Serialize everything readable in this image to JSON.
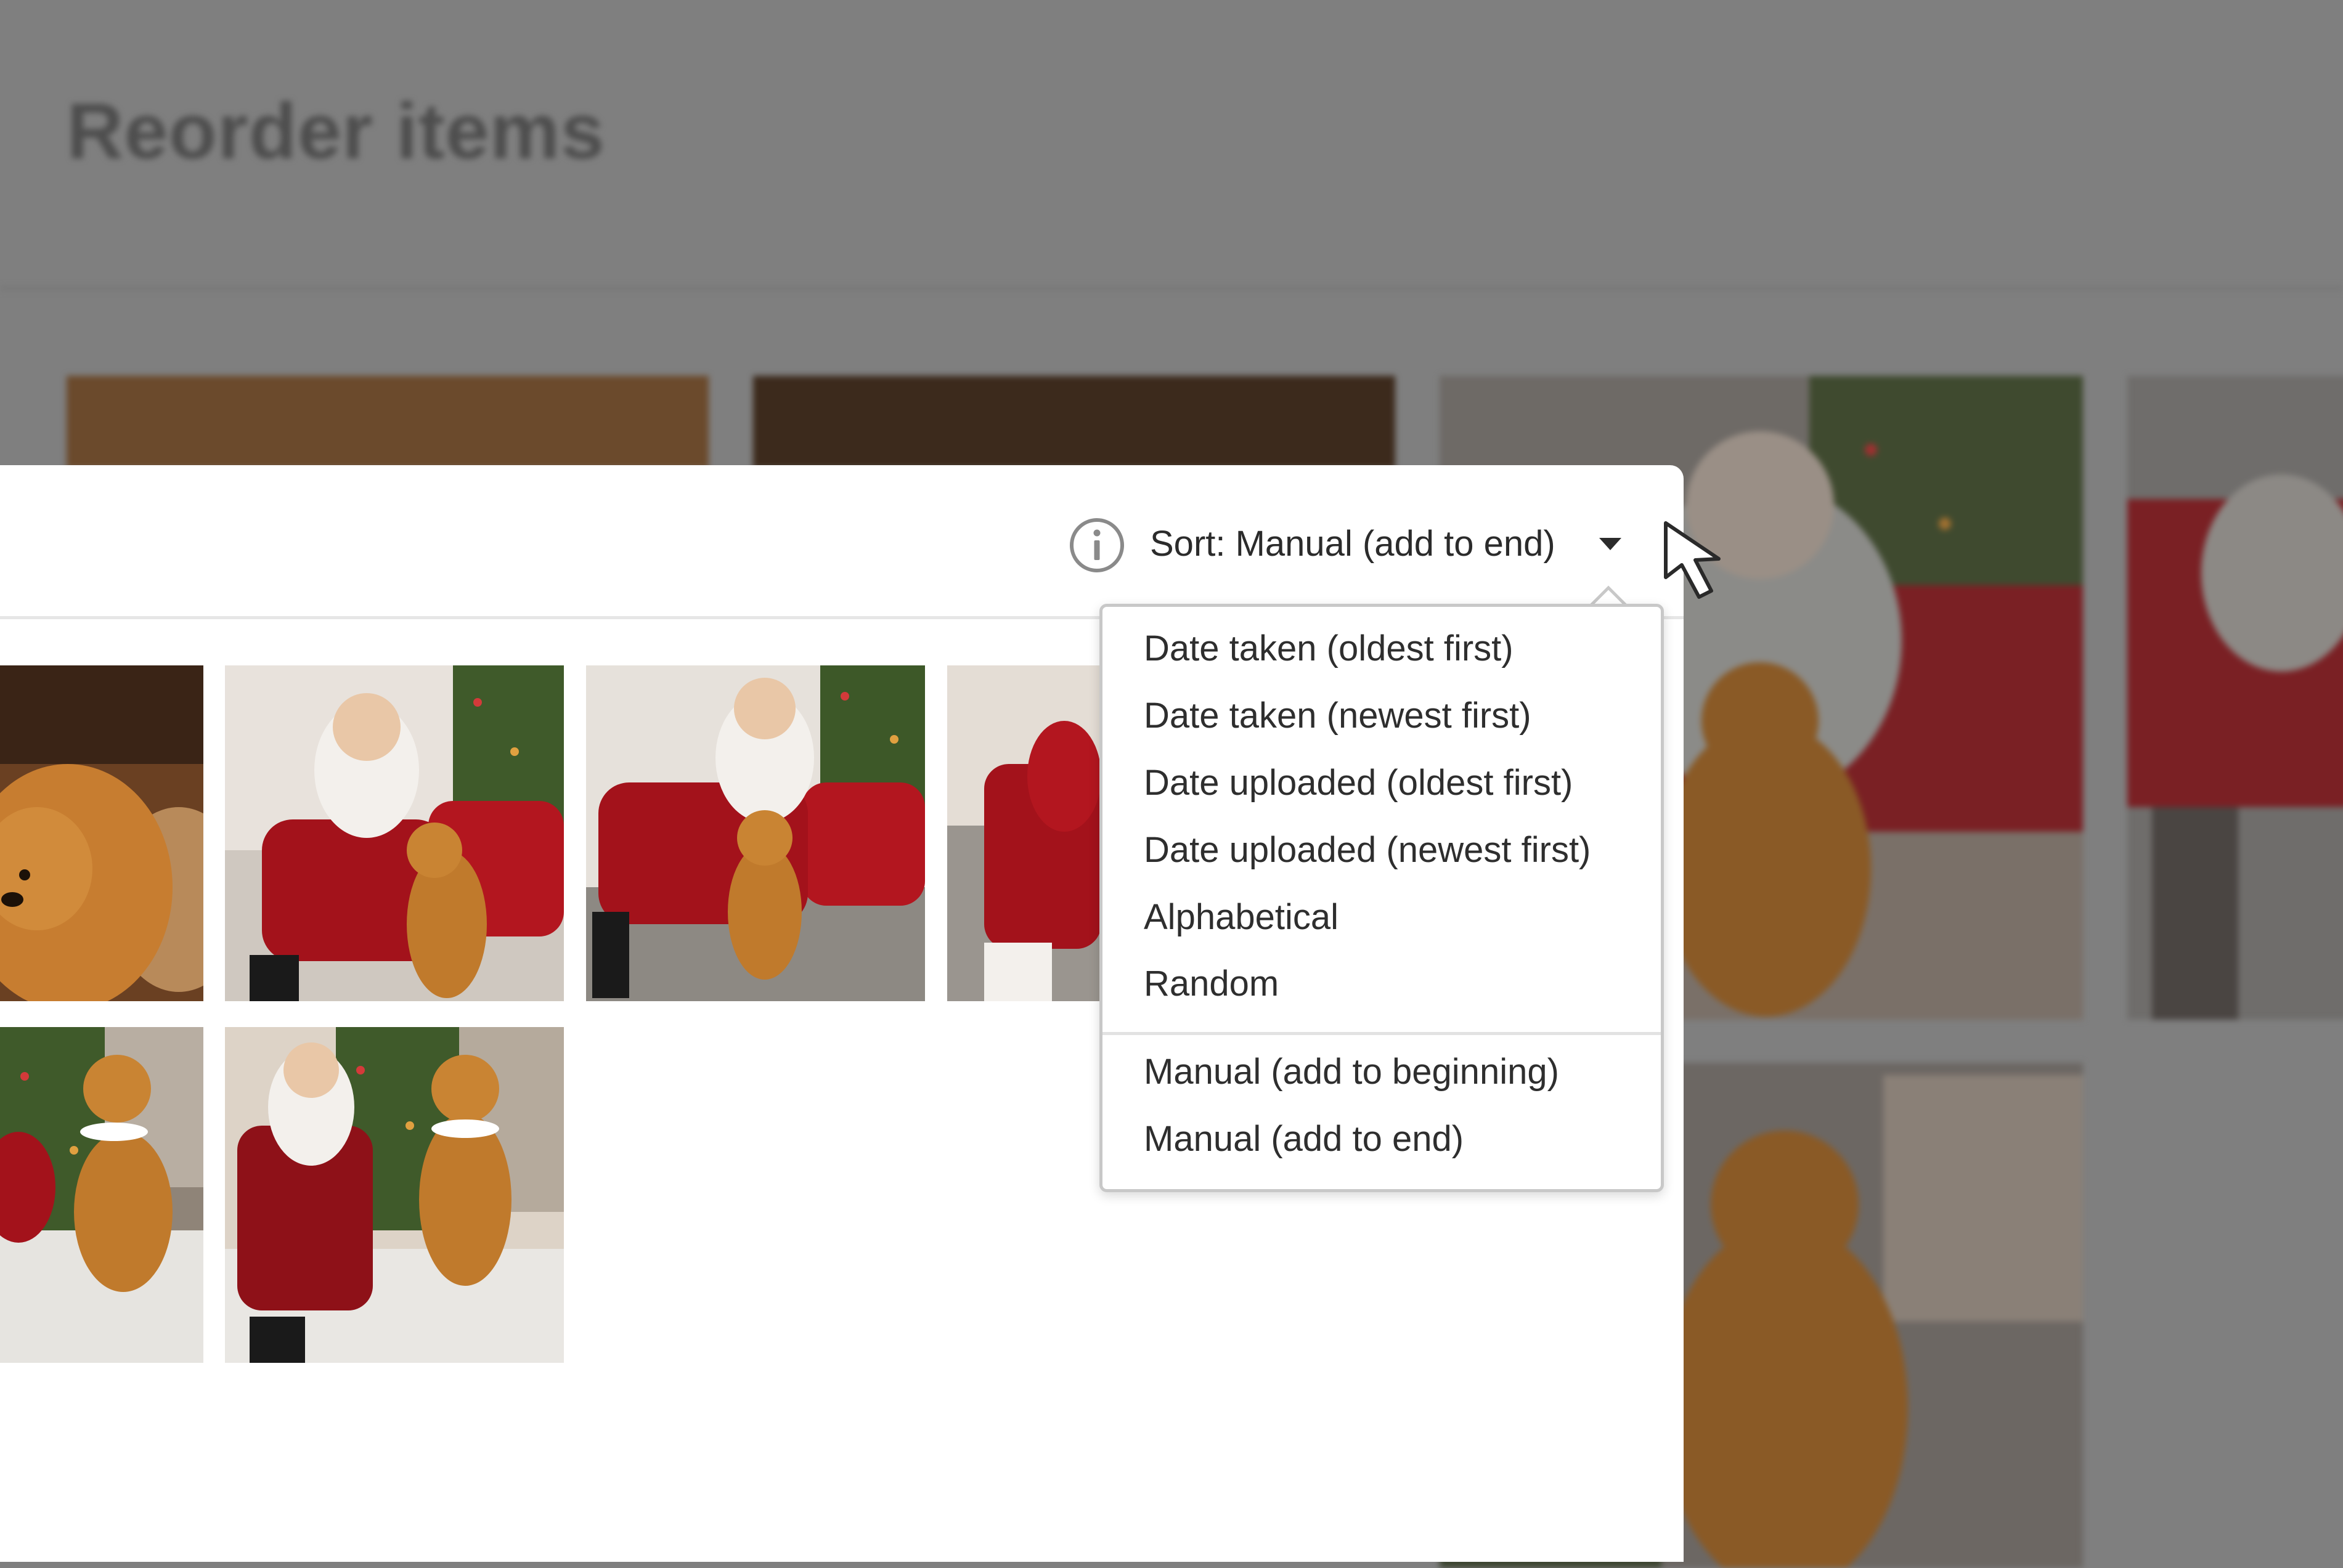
{
  "background": {
    "title": "Reorder items"
  },
  "toolbar": {
    "sort_label": "Sort: Manual (add to end)",
    "info_icon": "info-circle-icon",
    "caret_icon": "caret-down-icon"
  },
  "sort_menu": {
    "options": [
      "Date taken (oldest first)",
      "Date taken (newest first)",
      "Date uploaded (oldest first)",
      "Date uploaded (newest first)",
      "Alphabetical",
      "Random",
      "Manual (add to beginning)",
      "Manual (add to end)"
    ]
  },
  "colors": {
    "dim_overlay": "#7f7f7f",
    "panel": "#ffffff",
    "santa_red": "#b3161f",
    "dog_gold": "#c07a2c"
  },
  "pointer_icon": "mouse-pointer-icon"
}
